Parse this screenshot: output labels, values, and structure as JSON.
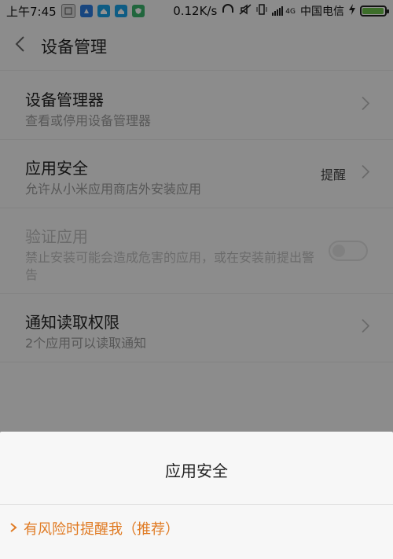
{
  "status_bar": {
    "time": "上午7:45",
    "network_speed": "0.12K/s",
    "carrier": "中国电信",
    "signal_label": "4G",
    "battery_level": 0.9,
    "battery_color": "#6cc24a",
    "icons": [
      "screenshot-icon",
      "app-icon-blue",
      "app-icon-cyan",
      "app-icon-teal",
      "app-icon-shield",
      "headphone-icon",
      "mute-icon",
      "vibrate-icon",
      "signal-icon",
      "charging-icon"
    ]
  },
  "header": {
    "title": "设备管理"
  },
  "rows": [
    {
      "label": "设备管理器",
      "desc": "查看或停用设备管理器"
    },
    {
      "label": "应用安全",
      "desc": "允许从小米应用商店外安装应用",
      "value": "提醒"
    },
    {
      "label": "验证应用",
      "desc": "禁止安装可能会造成危害的应用，或在安装前提出警告",
      "toggle_on": false
    },
    {
      "label": "通知读取权限",
      "desc": "2个应用可以读取通知"
    }
  ],
  "sheet": {
    "title": "应用安全",
    "options": [
      {
        "label": "有风险时提醒我（推荐）",
        "selected": true,
        "accent": "#e07b24"
      }
    ]
  }
}
